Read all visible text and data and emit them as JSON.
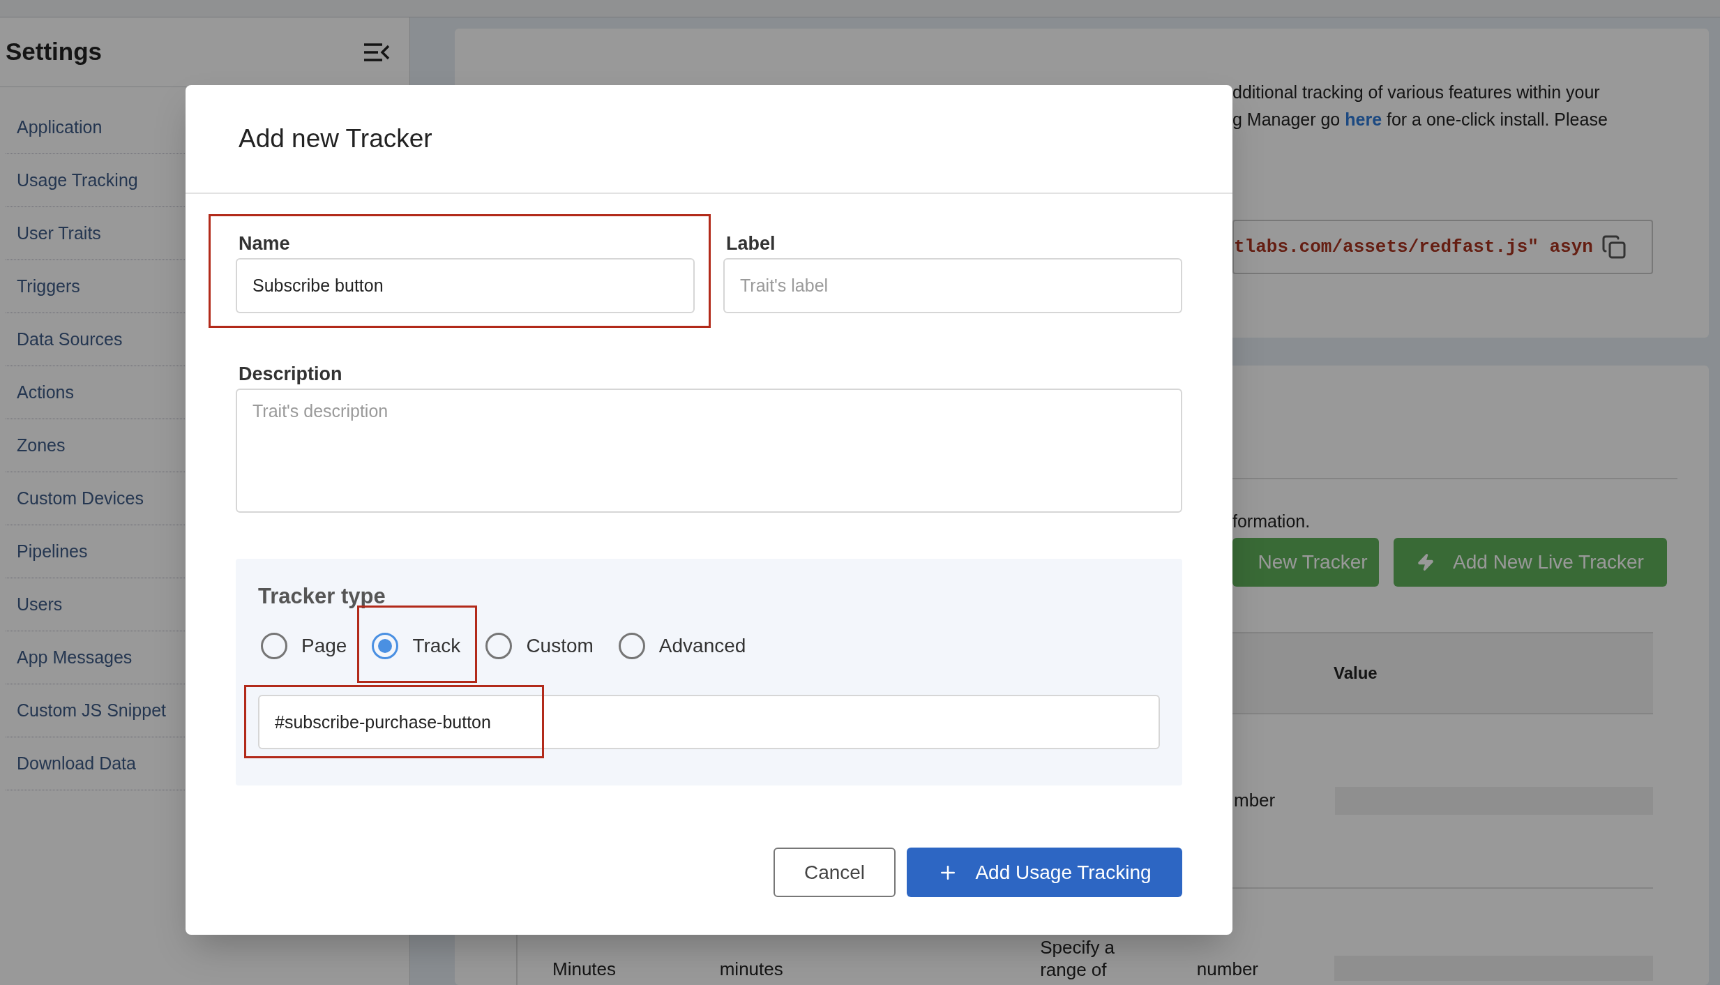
{
  "sidebar": {
    "title": "Settings",
    "items": [
      {
        "label": "Application"
      },
      {
        "label": "Usage Tracking"
      },
      {
        "label": "User Traits"
      },
      {
        "label": "Triggers"
      },
      {
        "label": "Data Sources"
      },
      {
        "label": "Actions"
      },
      {
        "label": "Zones"
      },
      {
        "label": "Custom Devices"
      },
      {
        "label": "Pipelines"
      },
      {
        "label": "Users"
      },
      {
        "label": "App Messages"
      },
      {
        "label": "Custom JS Snippet"
      },
      {
        "label": "Download Data"
      }
    ]
  },
  "intro": {
    "line_1": "dditional tracking of various features within your",
    "line_2_before": "g Manager go",
    "link": "here",
    "line_2_after": "for a one-click install. Please"
  },
  "snippet": "tlabs.com/assets/redfast.js\" asyn",
  "section_text": "formation.",
  "buttons": [
    {
      "label": "New Tracker",
      "kind": "plain"
    },
    {
      "label": "Add New Live Tracker",
      "kind": "live"
    }
  ],
  "table": {
    "columns": [
      "Value"
    ],
    "rows": [
      {
        "column_4": "mber"
      },
      {
        "column_1": "Minutes",
        "column_2": "minutes",
        "column_3": [
          "Specify a",
          "range of"
        ],
        "column_4": "number"
      }
    ]
  },
  "dialog": {
    "title": "Add new Tracker",
    "name": {
      "label": "Name",
      "value": "Subscribe button",
      "highlighted": true
    },
    "label": {
      "label": "Label",
      "placeholder": "Trait's label",
      "highlighted": false
    },
    "description": {
      "label": "Description",
      "placeholder": "Trait's description"
    },
    "tracker_type": {
      "title": "Tracker type",
      "options": [
        {
          "label": "Page",
          "selected": false,
          "highlighted": false
        },
        {
          "label": "Track",
          "selected": true,
          "highlighted": true
        },
        {
          "label": "Custom",
          "selected": false,
          "highlighted": false
        },
        {
          "label": "Advanced",
          "selected": false,
          "highlighted": false
        }
      ],
      "selector": {
        "value": "#subscribe-purchase-button",
        "highlighted": true
      }
    },
    "cancel": "Cancel",
    "submit": "Add Usage Tracking"
  }
}
